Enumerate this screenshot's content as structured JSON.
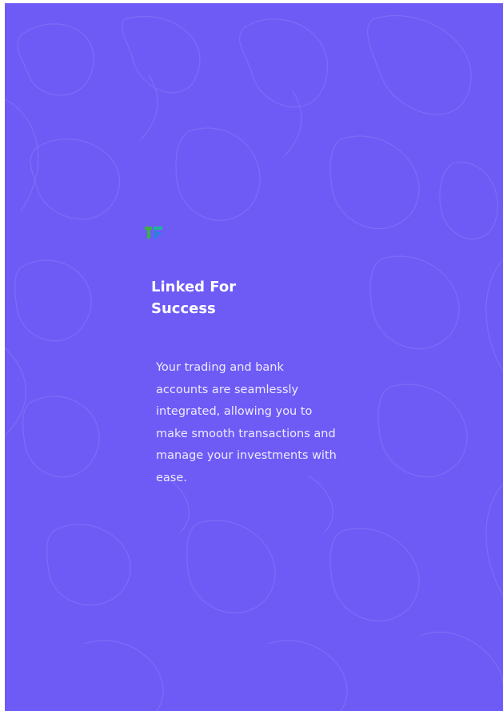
{
  "colors": {
    "background": "#6e5bf6",
    "pattern_stroke": "#8a7af8",
    "title_text": "#ffffff",
    "body_text": "#eeeaff",
    "logo_green": "#3fae49",
    "logo_blue": "#2b7fe0",
    "logo_teal": "#1fb39a"
  },
  "logo": {
    "icon": "brand-logo-icon"
  },
  "heading": {
    "line1": "Linked For",
    "line2": "Success"
  },
  "description": {
    "line1": "Your trading and bank",
    "line2": "accounts are seamlessly",
    "line3": "integrated, allowing you to",
    "line4": "make smooth transactions and",
    "line5": "manage your investments with",
    "line6": "ease."
  }
}
